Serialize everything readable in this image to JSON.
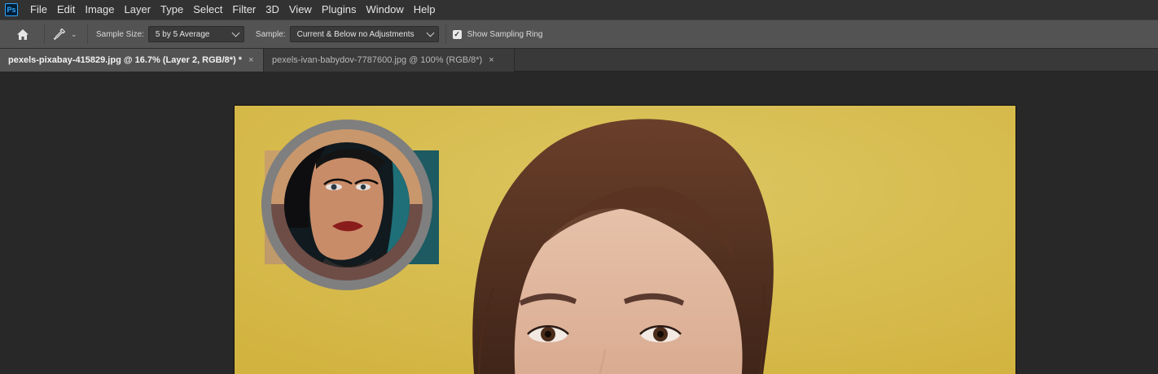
{
  "app": {
    "logo_text": "Ps"
  },
  "menu": [
    "File",
    "Edit",
    "Image",
    "Layer",
    "Type",
    "Select",
    "Filter",
    "3D",
    "View",
    "Plugins",
    "Window",
    "Help"
  ],
  "options": {
    "sample_size_label": "Sample Size:",
    "sample_size_value": "5 by 5 Average",
    "sample_label": "Sample:",
    "sample_value": "Current & Below no Adjustments",
    "show_sampling_ring_label": "Show Sampling Ring",
    "show_sampling_ring_checked": true
  },
  "tabs": [
    {
      "label": "pexels-pixabay-415829.jpg @ 16.7% (Layer 2, RGB/8*) *",
      "active": true,
      "close": "×"
    },
    {
      "label": "pexels-ivan-babydov-7787600.jpg @ 100% (RGB/8*)",
      "active": false,
      "close": "×"
    }
  ],
  "colors": {
    "sampling_ring_outer": "#7f7f7f",
    "sampled_color_new": "#c9976c",
    "sampled_color_current": "#6e4d47",
    "canvas_background": "#d7bb4c"
  }
}
